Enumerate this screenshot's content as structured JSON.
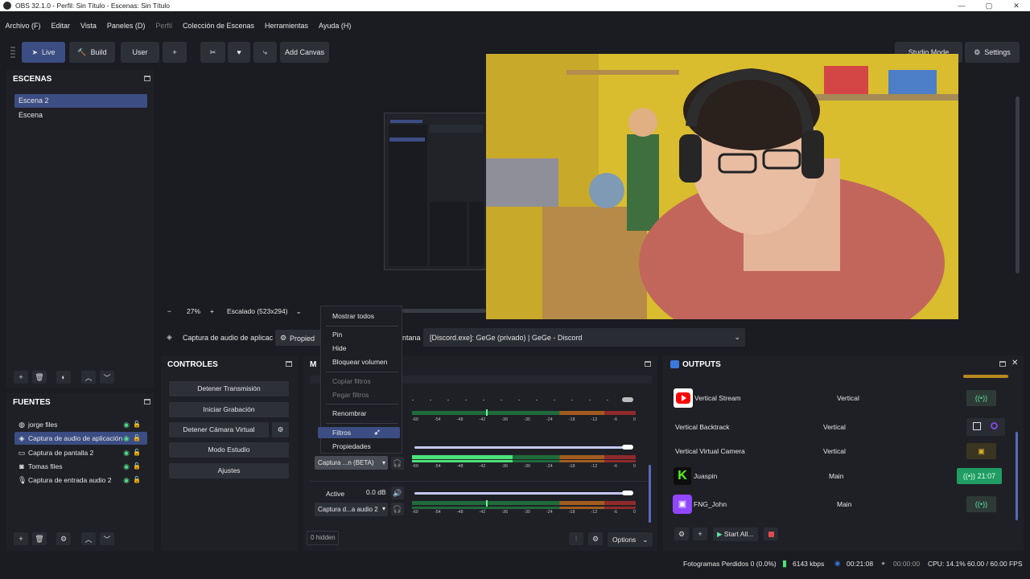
{
  "window": {
    "title": "OBS 32.1.0 - Perfil: Sin Título - Escenas: Sin Título",
    "minimize": "—",
    "maximize": "▢",
    "close": "✕"
  },
  "menu": [
    "Archivo (F)",
    "Editar",
    "Vista",
    "Paneles (D)",
    "Perfil",
    "Colección de Escenas",
    "Herramientas",
    "Ayuda (H)"
  ],
  "toolbar": {
    "live": "Live",
    "build": "Build",
    "user": "User",
    "add": "+",
    "add_canvas": "Add Canvas",
    "studio_mode": "Studio Mode",
    "settings": "Settings"
  },
  "scenes": {
    "title": "ESCENAS",
    "items": [
      "Escena 2",
      "Escena"
    ]
  },
  "sources": {
    "title": "FUENTES",
    "items": [
      "jorge files",
      "Captura de audio de aplicación",
      "Captura de pantalla 2",
      "Tomas files",
      "Captura de entrada audio 2"
    ]
  },
  "zoom": {
    "minus": "−",
    "value": "27%",
    "plus": "+",
    "scaling": "Escalado (523x294)"
  },
  "propbar": {
    "source": "Captura de audio de aplicac",
    "properties": "Propied",
    "window_label": "ntana",
    "window_value": "[Discord.exe]: GeGe (privado) | GeGe - Discord"
  },
  "controls": {
    "title": "CONTROLES",
    "buttons": [
      "Detener Transmisión",
      "Iniciar Grabación",
      "Detener Cámara Virtual",
      "Modo Estudio",
      "Ajustes"
    ]
  },
  "mixer": {
    "title": "M",
    "rows": [
      {
        "name": "Captura ...n (BETA)",
        "label": "",
        "db": ""
      },
      {
        "name": "Captura d...a audio 2",
        "label": "Active",
        "db": "0.0 dB"
      }
    ],
    "scale": [
      "-60",
      "-54",
      "-48",
      "-42",
      "-36",
      "-30",
      "-24",
      "-18",
      "-12",
      "-6",
      "0"
    ],
    "hidden": "0 hidden",
    "options": "Options"
  },
  "context_menu": {
    "items": [
      "Mostrar todos",
      "Pin",
      "Hide",
      "Bloquear volumen",
      "Copiar filtros",
      "Pegar filtros",
      "Renombrar",
      "Filtros",
      "Propiedades"
    ],
    "highlighted": "Filtros"
  },
  "outputs": {
    "title": "OUTPUTS",
    "rows": [
      {
        "name": "Vertical Stream",
        "type": "Vertical",
        "status": ""
      },
      {
        "name": "Vertical Backtrack",
        "type": "Vertical",
        "status": ""
      },
      {
        "name": "Vertical Virtual Camera",
        "type": "Vertical",
        "status": ""
      },
      {
        "name": "Juaspin",
        "type": "Main",
        "status": "21:07"
      },
      {
        "name": "FNG_John",
        "type": "Main",
        "status": ""
      }
    ],
    "start_all": "Start All...",
    "colors": {
      "youtube": "#ff0000",
      "kick": "#53fc18",
      "twitch": "#9146ff",
      "active_green": "#1f9d63"
    }
  },
  "status": {
    "dropped": "Fotogramas Perdidos 0 (0.0%)",
    "bitrate": "6143 kbps",
    "stream_time": "00:21:08",
    "rec_time": "00:00:00",
    "cpu": "CPU: 14.1%",
    "fps": "60.00 / 60.00 FPS"
  }
}
